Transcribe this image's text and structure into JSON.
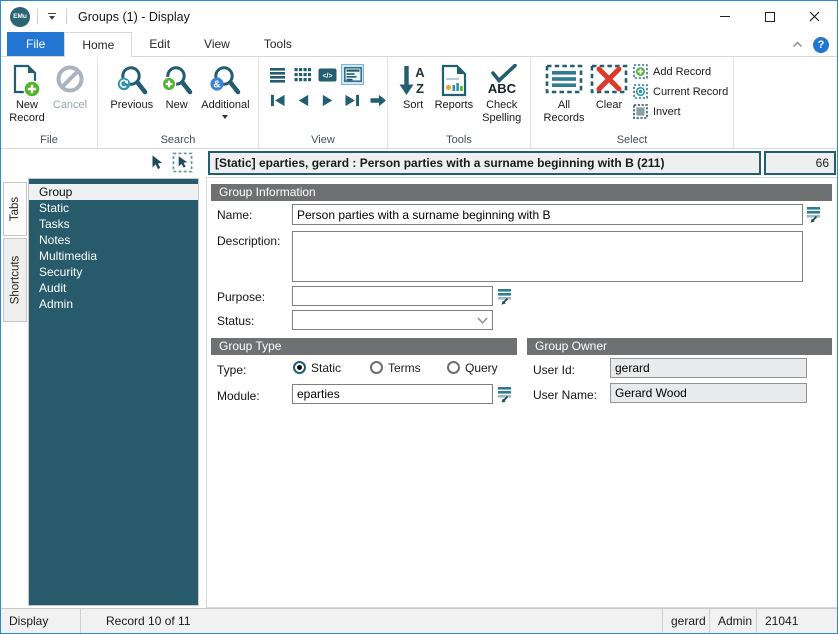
{
  "window": {
    "title": "Groups (1) - Display",
    "logo_text": "EMu"
  },
  "ribbon": {
    "tabs": [
      {
        "label": "File"
      },
      {
        "label": "Home"
      },
      {
        "label": "Edit"
      },
      {
        "label": "View"
      },
      {
        "label": "Tools"
      }
    ],
    "active_tab": "Home",
    "file_group": {
      "label": "File",
      "new_record": "New Record",
      "cancel": "Cancel"
    },
    "search_group": {
      "label": "Search",
      "previous": "Previous",
      "new": "New",
      "additional": "Additional"
    },
    "view_group": {
      "label": "View"
    },
    "tools_group": {
      "label": "Tools",
      "sort": "Sort",
      "reports": "Reports",
      "check_spelling": "Check Spelling"
    },
    "select_group": {
      "label": "Select",
      "all_records": "All Records",
      "clear": "Clear",
      "add_record": "Add Record",
      "current_record": "Current Record",
      "invert": "Invert"
    }
  },
  "icons": {
    "sort_letter_top": "A",
    "sort_letter_bottom": "Z",
    "spellcheck_text": "ABC",
    "additional_badge": "&",
    "help_glyph": "?",
    "code_view_text": "</>"
  },
  "record_header": {
    "title": "[Static] eparties, gerard : Person parties with a surname beginning with B (211)",
    "count": "66"
  },
  "sidebar": {
    "vertical_tabs": [
      "Tabs",
      "Shortcuts"
    ],
    "items": [
      "Group",
      "Static",
      "Tasks",
      "Notes",
      "Multimedia",
      "Security",
      "Audit",
      "Admin"
    ],
    "selected_item": "Group"
  },
  "form": {
    "group_information": {
      "title": "Group Information",
      "name_label": "Name:",
      "name_value": "Person parties with a surname beginning with B",
      "description_label": "Description:",
      "description_value": "",
      "purpose_label": "Purpose:",
      "purpose_value": "",
      "status_label": "Status:",
      "status_value": ""
    },
    "group_type": {
      "title": "Group Type",
      "type_label": "Type:",
      "option_static": "Static",
      "option_terms": "Terms",
      "option_query": "Query",
      "selected_type": "Static",
      "module_label": "Module:",
      "module_value": "eparties"
    },
    "group_owner": {
      "title": "Group Owner",
      "user_id_label": "User Id:",
      "user_id_value": "gerard",
      "user_name_label": "User Name:",
      "user_name_value": "Gerard Wood"
    }
  },
  "statusbar": {
    "mode": "Display",
    "record_position": "Record 10 of 11",
    "user": "gerard",
    "role": "Admin",
    "code": "21041"
  },
  "colors": {
    "accent_teal": "#235e70",
    "sidebar_teal": "#275b6c",
    "file_tab_blue": "#2276d2",
    "green": "#54b32e",
    "red": "#d93a2b",
    "disabled_gray": "#a9b4c0"
  }
}
